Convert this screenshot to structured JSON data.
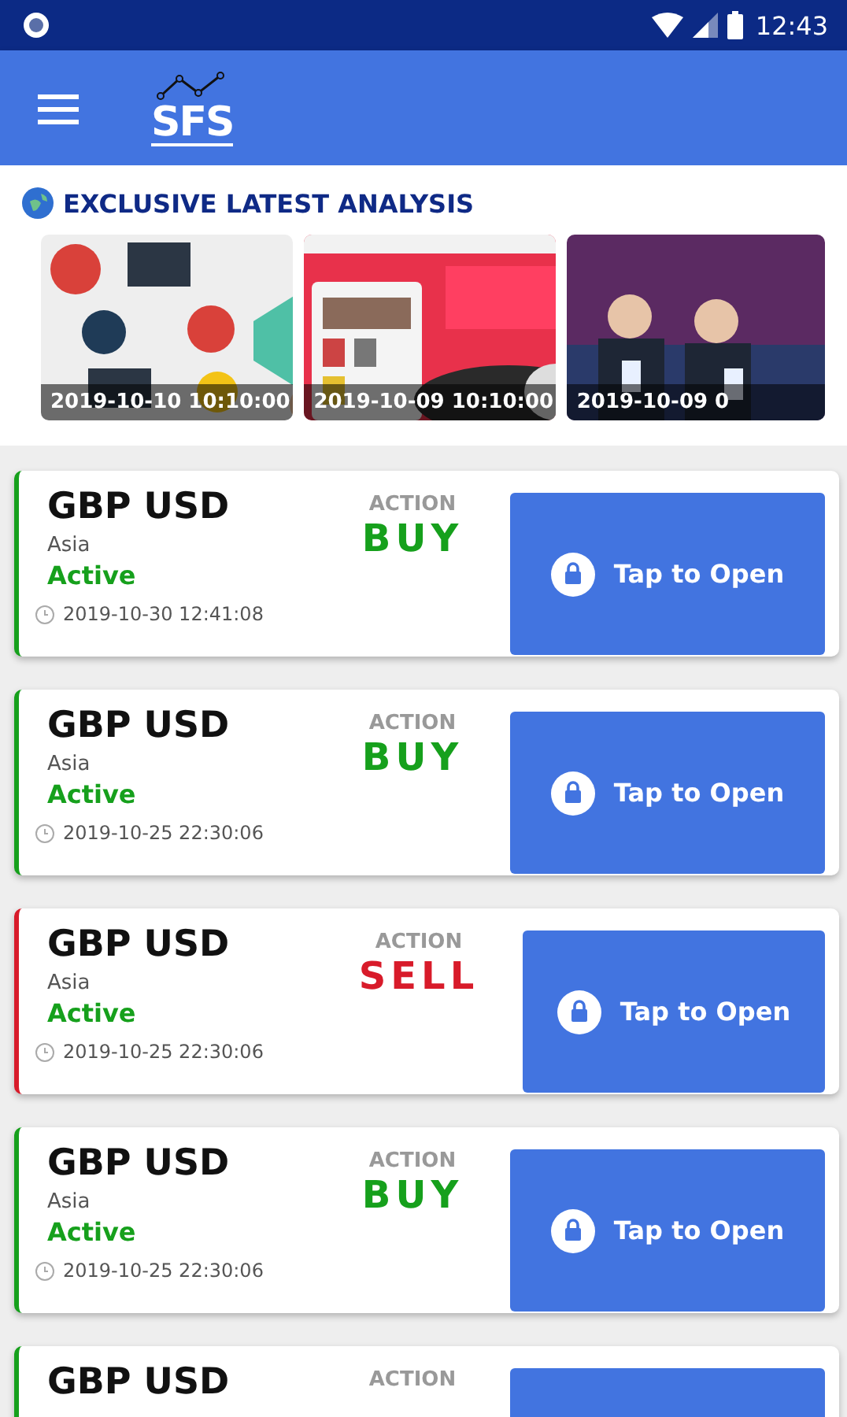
{
  "status_bar": {
    "time": "12:43"
  },
  "app_bar": {
    "logo": "SFS"
  },
  "analysis": {
    "title": "EXCLUSIVE LATEST ANALYSIS",
    "items": [
      {
        "kind": "picture",
        "timestamp": "2019-10-10 10:10:00"
      },
      {
        "kind": "picture",
        "timestamp": "2019-10-09 10:10:00"
      },
      {
        "kind": "picture",
        "timestamp": "2019-10-09 0"
      }
    ]
  },
  "signals": [
    {
      "pair": "GBP USD",
      "region": "Asia",
      "status": "Active",
      "action_label": "ACTION",
      "action": "BUY",
      "kind": "buy",
      "time": "2019-10-30 12:41:08",
      "button": "Tap to Open"
    },
    {
      "pair": "GBP USD",
      "region": "Asia",
      "status": "Active",
      "action_label": "ACTION",
      "action": "BUY",
      "kind": "buy",
      "time": "2019-10-25 22:30:06",
      "button": "Tap to Open"
    },
    {
      "pair": "GBP USD",
      "region": "Asia",
      "status": "Active",
      "action_label": "ACTION",
      "action": "SELL",
      "kind": "sell",
      "time": "2019-10-25 22:30:06",
      "button": "Tap to Open"
    },
    {
      "pair": "GBP USD",
      "region": "Asia",
      "status": "Active",
      "action_label": "ACTION",
      "action": "BUY",
      "kind": "buy",
      "time": "2019-10-25 22:30:06",
      "button": "Tap to Open"
    },
    {
      "pair": "GBP USD",
      "action_label": "ACTION",
      "kind": "buy"
    }
  ]
}
